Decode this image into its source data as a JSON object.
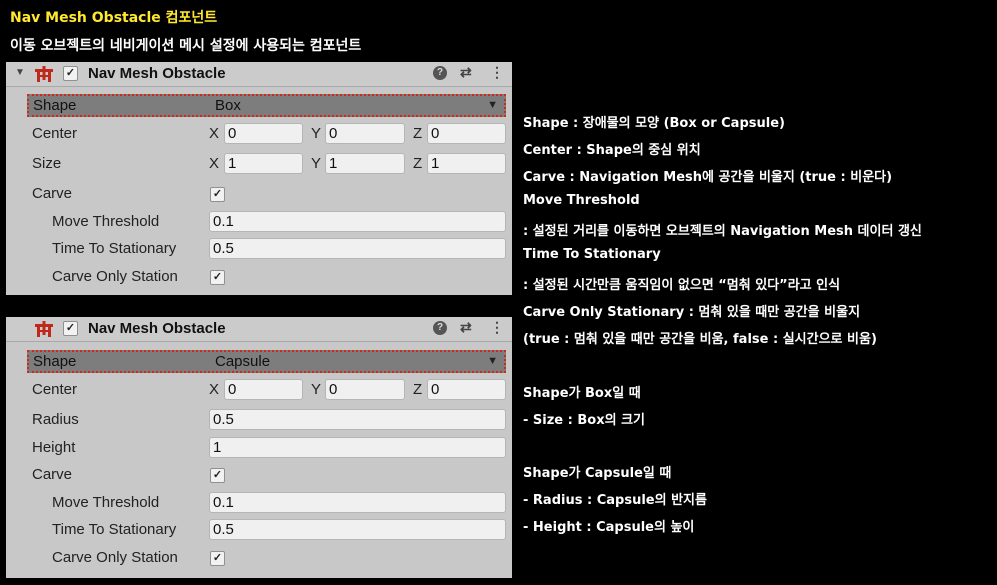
{
  "header": {
    "title": "Nav Mesh Obstacle 컴포넌트",
    "subtitle": "이동 오브젝트의 네비게이션 메시 설정에 사용되는 컴포넌트"
  },
  "panels": [
    {
      "component_name": "Nav Mesh Obstacle",
      "shape_label": "Shape",
      "shape_value": "Box",
      "center": {
        "label": "Center",
        "x": "0",
        "y": "0",
        "z": "0"
      },
      "size": {
        "label": "Size",
        "x": "1",
        "y": "1",
        "z": "1"
      },
      "carve_label": "Carve",
      "move_threshold": {
        "label": "Move Threshold",
        "value": "0.1"
      },
      "time_to_stationary": {
        "label": "Time To Stationary",
        "value": "0.5"
      },
      "carve_only_label": "Carve Only Station"
    },
    {
      "component_name": "Nav Mesh Obstacle",
      "shape_label": "Shape",
      "shape_value": "Capsule",
      "center": {
        "label": "Center",
        "x": "0",
        "y": "0",
        "z": "0"
      },
      "radius": {
        "label": "Radius",
        "value": "0.5"
      },
      "height": {
        "label": "Height",
        "value": "1"
      },
      "carve_label": "Carve",
      "move_threshold": {
        "label": "Move Threshold",
        "value": "0.1"
      },
      "time_to_stationary": {
        "label": "Time To Stationary",
        "value": "0.5"
      },
      "carve_only_label": "Carve Only Station"
    }
  ],
  "axes": {
    "x": "X",
    "y": "Y",
    "z": "Z"
  },
  "icons": {
    "fold": "triangle-down-icon",
    "component": "nav-mesh-obstacle-icon",
    "help": "help-icon",
    "preset": "preset-sliders-icon",
    "menu": "kebab-menu-icon",
    "dropdown": "chevron-down-icon"
  },
  "notes": [
    "Shape : 장애물의 모양 (Box or Capsule)",
    "Center : Shape의 중심 위치",
    "Carve : Navigation Mesh에 공간을 비울지 (true : 비운다)",
    "Move Threshold",
    " : 설정된 거리를 이동하면 오브젝트의 Navigation Mesh 데이터 갱신",
    "Time To Stationary",
    " : 설정된 시간만큼 움직임이 없으면 “멈춰 있다”라고 인식",
    "Carve Only Stationary : 멈춰 있을 때만 공간을 비울지",
    "(true : 멈춰 있을 때만 공간을 비움, false : 실시간으로 비움)",
    "Shape가 Box일 때",
    " - Size : Box의 크기",
    "Shape가 Capsule일 때",
    " - Radius : Capsule의 반지름",
    " - Height : Capsule의 높이"
  ],
  "colors": {
    "title": "#ffe82e",
    "panel_bg": "#c8c8c8",
    "highlight_border": "#d2261a",
    "icon_red": "#c0281c"
  }
}
